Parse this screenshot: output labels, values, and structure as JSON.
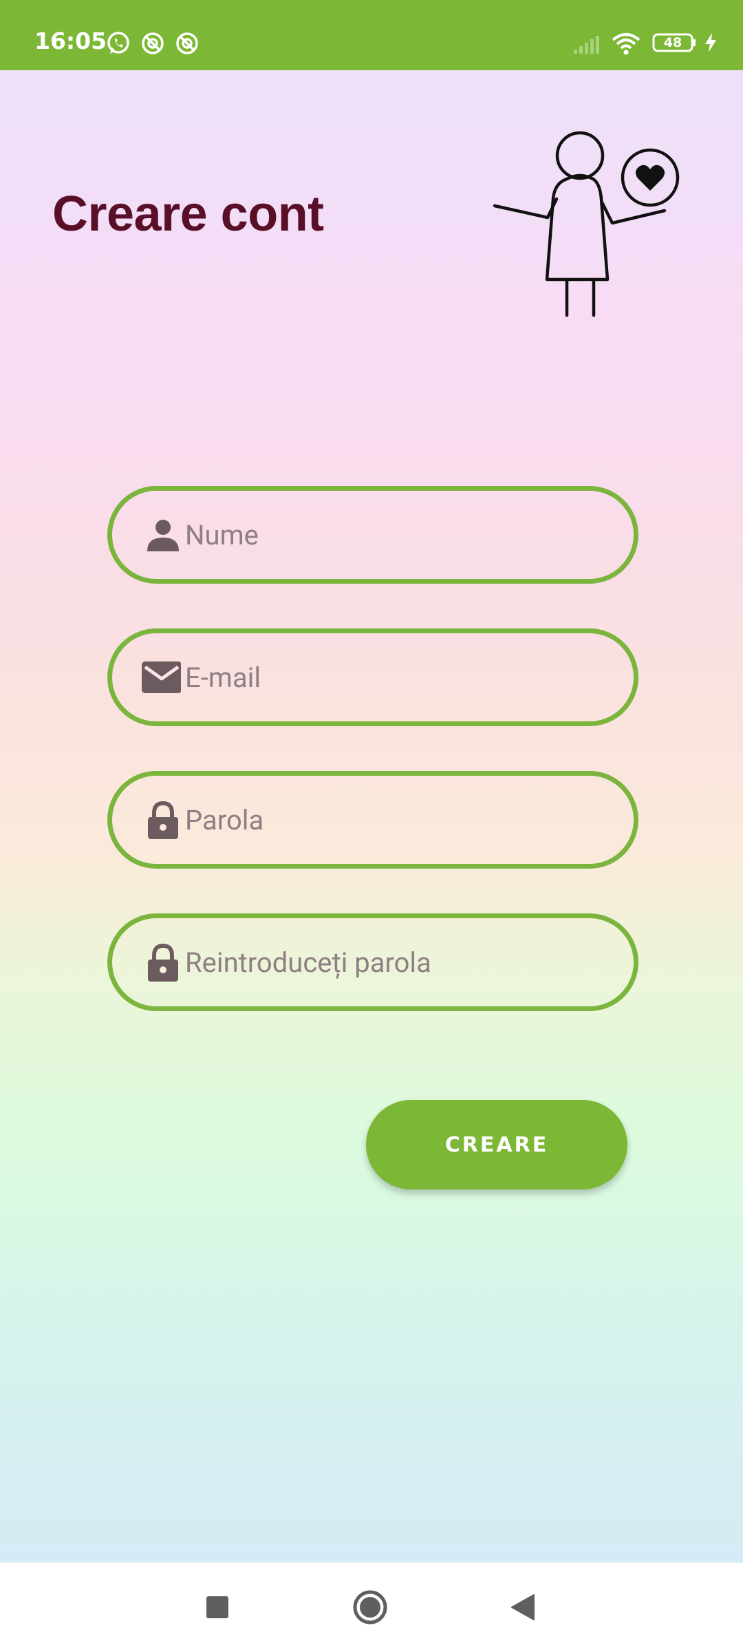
{
  "status_bar": {
    "time": "16:05",
    "notification_icons": [
      "whatsapp-icon",
      "app-notification-icon",
      "app-notification-icon"
    ],
    "battery_level": "48",
    "icons": [
      "signal-icon",
      "wifi-icon",
      "battery-icon",
      "charging-icon"
    ],
    "background_color": "#7cb736"
  },
  "screen": {
    "title": "Creare cont",
    "illustration": "person-with-heart-illustration"
  },
  "form": {
    "fields": [
      {
        "icon": "person-icon",
        "placeholder": "Nume",
        "value": ""
      },
      {
        "icon": "mail-icon",
        "placeholder": "E-mail",
        "value": ""
      },
      {
        "icon": "lock-icon",
        "placeholder": "Parola",
        "value": ""
      },
      {
        "icon": "lock-icon",
        "placeholder": "Reintroduceți parola",
        "value": ""
      }
    ],
    "submit_label": "CREARE",
    "accent_color": "#7cb53d",
    "title_color": "#5a0f28"
  },
  "nav_bar": {
    "buttons": [
      "recents-square-icon",
      "home-circle-icon",
      "back-triangle-icon"
    ]
  }
}
